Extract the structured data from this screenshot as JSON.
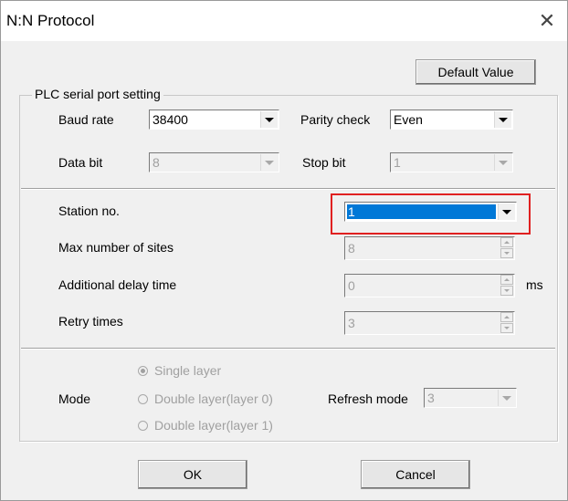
{
  "dialog": {
    "title": "N:N Protocol"
  },
  "default_button": "Default Value",
  "serial_group": {
    "legend": "PLC serial port setting",
    "baud_rate": {
      "label": "Baud rate",
      "value": "38400"
    },
    "parity_check": {
      "label": "Parity check",
      "value": "Even"
    },
    "data_bit": {
      "label": "Data bit",
      "value": "8"
    },
    "stop_bit": {
      "label": "Stop bit",
      "value": "1"
    }
  },
  "station": {
    "station_no": {
      "label": "Station no.",
      "value": "1"
    },
    "max_sites": {
      "label": "Max number of sites",
      "value": "8"
    },
    "delay": {
      "label": "Additional delay time",
      "value": "0",
      "unit": "ms"
    },
    "retry": {
      "label": "Retry times",
      "value": "3"
    }
  },
  "mode": {
    "label": "Mode",
    "options": [
      "Single layer",
      "Double layer(layer 0)",
      "Double layer(layer 1)"
    ],
    "selected_index": 0,
    "refresh_label": "Refresh mode",
    "refresh_value": "3"
  },
  "buttons": {
    "ok": "OK",
    "cancel": "Cancel"
  },
  "colors": {
    "highlight_box": "#e02020",
    "selection": "#0078d7"
  }
}
